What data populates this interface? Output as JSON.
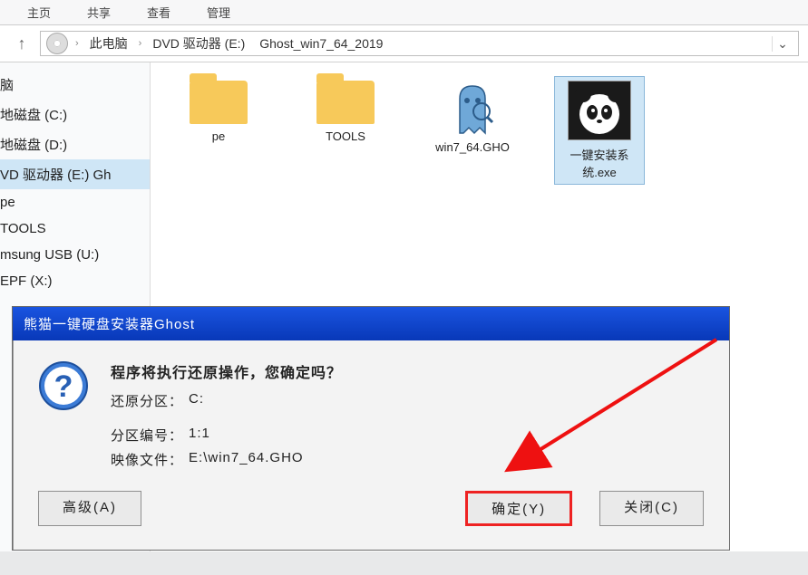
{
  "menubar": {
    "m1": "主页",
    "m2": "共享",
    "m3": "查看",
    "m4": "管理"
  },
  "address": {
    "root": "此电脑",
    "drive": "DVD 驱动器 (E:)",
    "folder": "Ghost_win7_64_2019"
  },
  "sidebar": {
    "items": [
      "脑",
      "地磁盘 (C:)",
      "地磁盘 (D:)",
      "VD 驱动器 (E:) Gh",
      "pe",
      "TOOLS",
      "msung USB (U:)",
      "EPF (X:)"
    ]
  },
  "files": {
    "f1": "pe",
    "f2": "TOOLS",
    "f3": "win7_64.GHO",
    "f4": "一键安装系统.exe"
  },
  "dialog": {
    "title": "熊猫一键硬盘安装器Ghost",
    "message": "程序将执行还原操作，您确定吗？",
    "partition_label": "还原分区：",
    "partition_value": "C:",
    "partno_label": "分区编号：",
    "partno_value": "1:1",
    "image_label": "映像文件：",
    "image_value": "E:\\win7_64.GHO",
    "btn_adv": "高级(A)",
    "btn_ok": "确定(Y)",
    "btn_close": "关闭(C)"
  }
}
